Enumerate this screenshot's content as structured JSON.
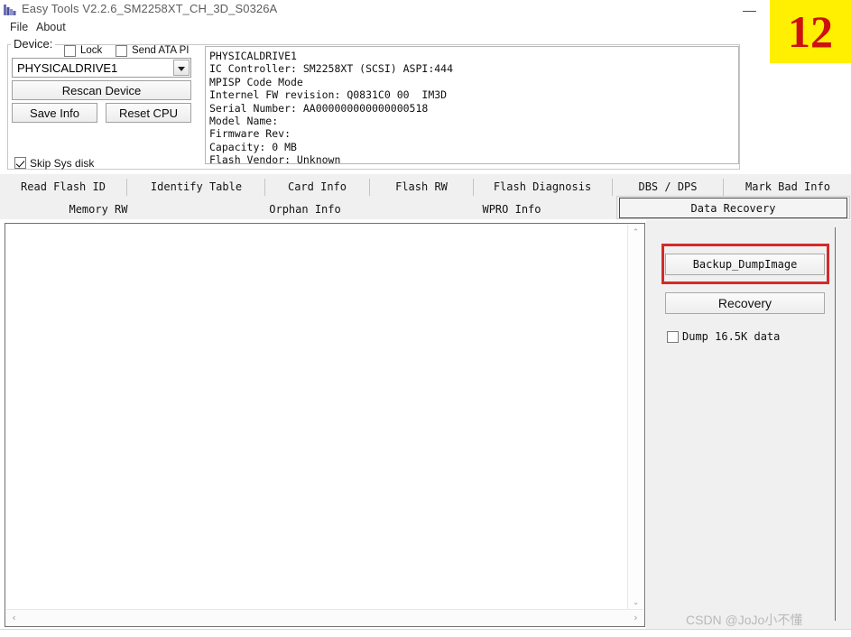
{
  "window": {
    "title": "Easy Tools V2.2.6_SM2258XT_CH_3D_S0326A",
    "icon": "app-icon",
    "minimize_label": "–"
  },
  "menubar": {
    "items": [
      {
        "label": "File"
      },
      {
        "label": "About"
      }
    ]
  },
  "device_group": {
    "legend": "Device:",
    "checkboxes": [
      {
        "label": "Lock",
        "checked": false
      },
      {
        "label": "Send ATA PI",
        "checked": false
      },
      {
        "label": "Skip Sys disk",
        "checked": true
      }
    ],
    "combo": {
      "value": "PHYSICALDRIVE1",
      "options": [
        "PHYSICALDRIVE1"
      ]
    },
    "buttons": {
      "rescan": "Rescan Device",
      "save_info": "Save Info",
      "reset_cpu": "Reset CPU"
    },
    "info_text": "PHYSICALDRIVE1\nIC Controller: SM2258XT (SCSI) ASPI:444\nMPISP Code Mode\nInternel FW revision: Q0831C0 00  IM3D\nSerial Number: AA000000000000000518\nModel Name:\nFirmware Rev:\nCapacity: 0 MB\nFlash Vendor: Unknown",
    "info_lines": [
      "PHYSICALDRIVE1",
      "IC Controller: SM2258XT (SCSI) ASPI:444",
      "MPISP Code Mode",
      "Internel FW revision: Q0831C0 00  IM3D",
      "Serial Number: AA000000000000000518",
      "Model Name:",
      "Firmware Rev:",
      "Capacity: 0 MB",
      "Flash Vendor: Unknown"
    ]
  },
  "tabs": {
    "row1": [
      {
        "label": "Read Flash ID",
        "selected": false
      },
      {
        "label": "Identify Table",
        "selected": false
      },
      {
        "label": "Card Info",
        "selected": false
      },
      {
        "label": "Flash RW",
        "selected": false
      },
      {
        "label": "Flash Diagnosis",
        "selected": false
      },
      {
        "label": "DBS / DPS",
        "selected": false
      },
      {
        "label": "Mark Bad Info",
        "selected": false
      }
    ],
    "row2": [
      {
        "label": "Memory RW",
        "selected": false
      },
      {
        "label": "Orphan Info",
        "selected": false
      },
      {
        "label": "WPRO Info",
        "selected": false
      },
      {
        "label": "Data Recovery",
        "selected": true
      }
    ],
    "selected": "Data Recovery"
  },
  "content": {
    "text": ""
  },
  "scrollbars": {
    "vertical": {
      "up_arrow": "⌃",
      "down_arrow": "⌄"
    },
    "horizontal": {
      "left_arrow": "‹",
      "right_arrow": "›"
    }
  },
  "right_panel": {
    "backup_button": "Backup_DumpImage",
    "recovery_button": "Recovery",
    "dump_checkbox": {
      "label": "Dump 16.5K data",
      "checked": false
    }
  },
  "annotations": {
    "highlight_target": "Backup_DumpImage",
    "highlight_color": "#d42a2a",
    "badge": {
      "text": "12",
      "background": "#ffef00",
      "text_color": "#cc1111"
    }
  },
  "watermark": {
    "text": "CSDN @JoJo小不懂"
  }
}
